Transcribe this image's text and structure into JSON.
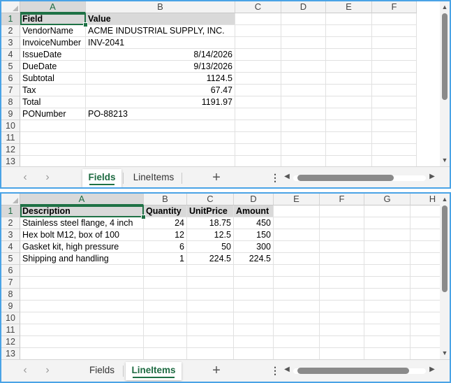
{
  "colors": {
    "accent": "#1e7145",
    "pane_border": "#4aa3e6",
    "header_fill": "#d9d9d9"
  },
  "top": {
    "columns": [
      "A",
      "B",
      "C",
      "D",
      "E",
      "F"
    ],
    "rows": [
      "1",
      "2",
      "3",
      "4",
      "5",
      "6",
      "7",
      "8",
      "9",
      "10",
      "11",
      "12",
      "13"
    ],
    "cells": [
      [
        "Field",
        "Value"
      ],
      [
        "VendorName",
        "ACME INDUSTRIAL SUPPLY, INC."
      ],
      [
        "InvoiceNumber",
        "INV-2041"
      ],
      [
        "IssueDate",
        "8/14/2026"
      ],
      [
        "DueDate",
        "9/13/2026"
      ],
      [
        "Subtotal",
        "1124.5"
      ],
      [
        "Tax",
        "67.47"
      ],
      [
        "Total",
        "1191.97"
      ],
      [
        "PONumber",
        "PO-88213"
      ]
    ],
    "tabs": [
      "Fields",
      "LineItems"
    ],
    "active_tab": "Fields"
  },
  "bottom": {
    "columns": [
      "A",
      "B",
      "C",
      "D",
      "E",
      "F",
      "G",
      "H"
    ],
    "rows": [
      "1",
      "2",
      "3",
      "4",
      "5",
      "6",
      "7",
      "8",
      "9",
      "10",
      "11",
      "12",
      "13"
    ],
    "cells": [
      [
        "Description",
        "Quantity",
        "UnitPrice",
        "Amount"
      ],
      [
        "Stainless steel flange, 4 inch",
        "24",
        "18.75",
        "450"
      ],
      [
        "Hex bolt M12, box of 100",
        "12",
        "12.5",
        "150"
      ],
      [
        "Gasket kit, high pressure",
        "6",
        "50",
        "300"
      ],
      [
        "Shipping and handling",
        "1",
        "224.5",
        "224.5"
      ]
    ],
    "tabs": [
      "Fields",
      "LineItems"
    ],
    "active_tab": "LineItems"
  },
  "icons": {
    "nav_prev": "chevron-left-icon",
    "nav_next": "chevron-right-icon",
    "add_sheet": "plus-icon",
    "more": "vertical-ellipsis-icon"
  },
  "glyphs": {
    "prev": "‹",
    "next": "›",
    "plus": "+",
    "dots": "⋮",
    "left": "◀",
    "right": "▶",
    "up": "▲",
    "down": "▼"
  }
}
